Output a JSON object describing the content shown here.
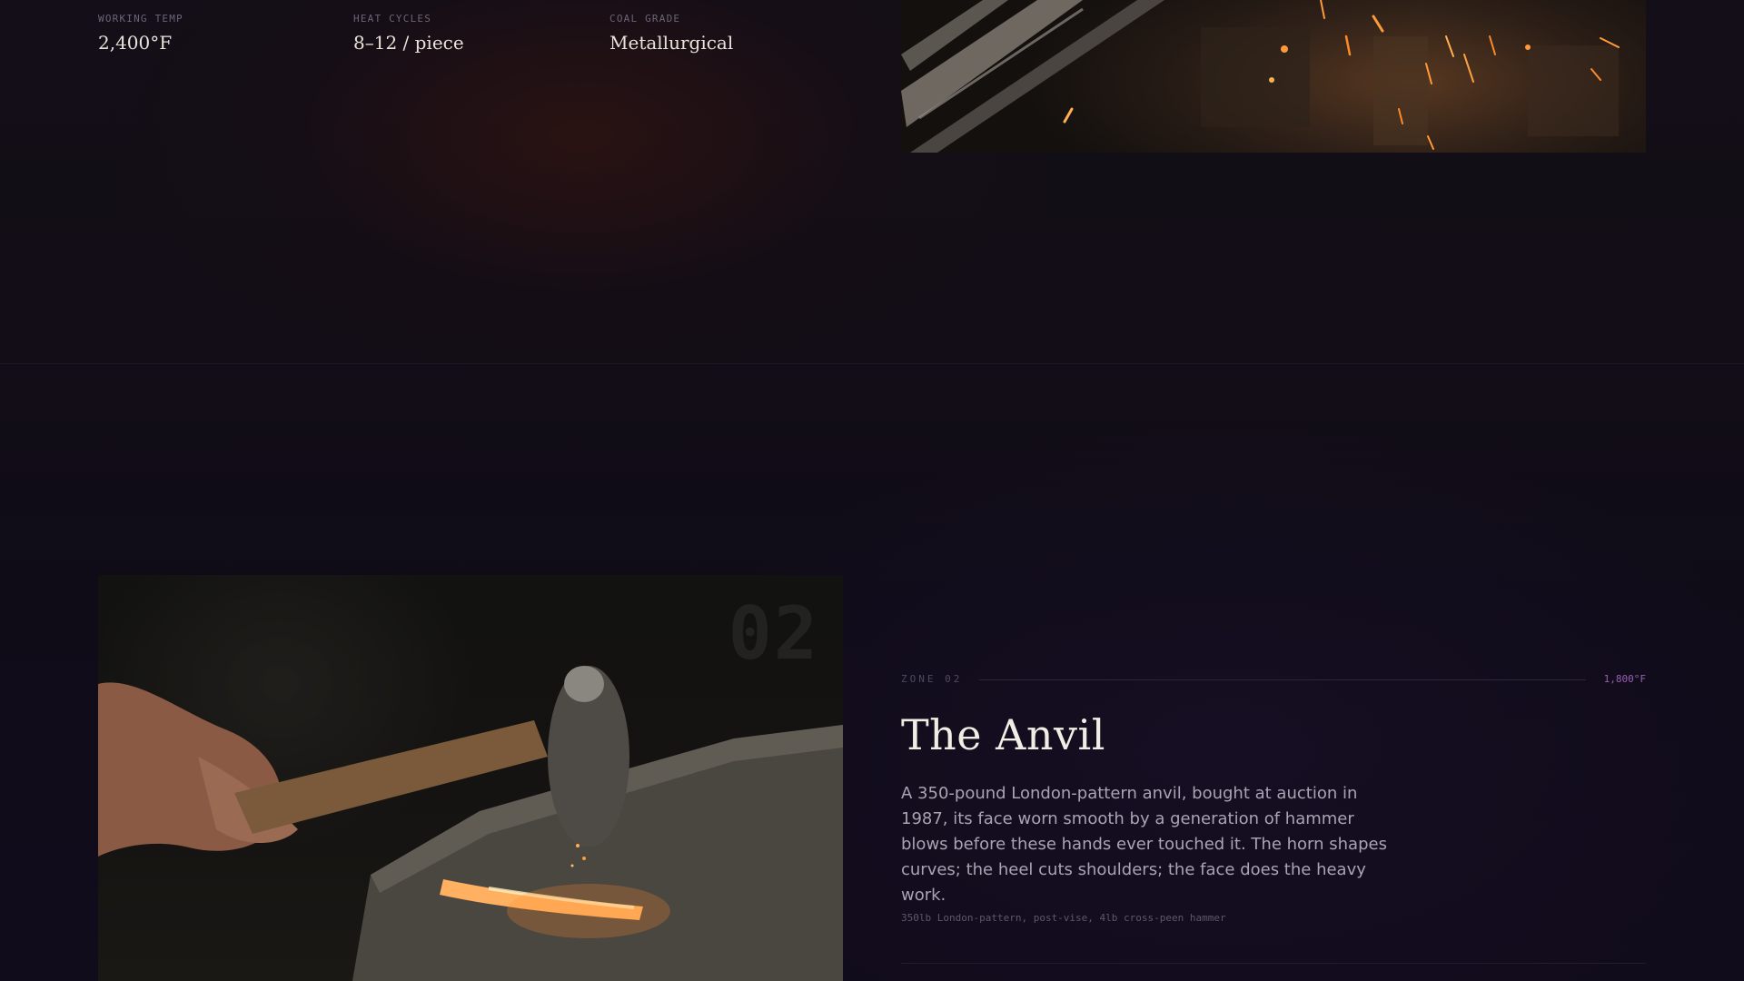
{
  "forge": {
    "stats": [
      {
        "label": "WORKING TEMP",
        "value": "2,400°F"
      },
      {
        "label": "HEAT CYCLES",
        "value": "8–12 / piece"
      },
      {
        "label": "COAL GRADE",
        "value": "Metallurgical"
      }
    ]
  },
  "anvil": {
    "zone_number": "02",
    "zone_label": "ZONE 02",
    "temperature": "1,800°F",
    "title": "The Anvil",
    "description": "A 350-pound London-pattern anvil, bought at auction in 1987, its face worn smooth by a generation of hammer blows before these hands ever touched it. The horn shapes curves; the heel cuts shoulders; the face does the heavy work.",
    "spec": "350lb London-pattern, post-vise, 4lb cross-peen hammer"
  },
  "colors": {
    "background": "#0e0b17",
    "accent_temperature": "#9a5fb2",
    "heading_text": "#f1ece4",
    "ember": "#ff9a3a"
  }
}
